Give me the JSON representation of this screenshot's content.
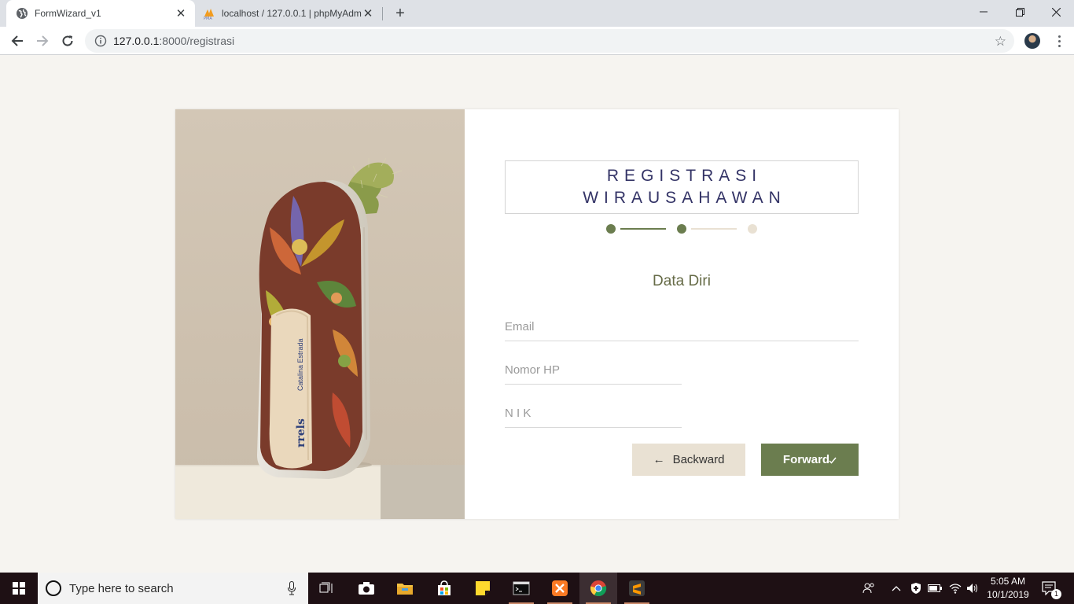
{
  "browser": {
    "tabs": [
      {
        "title": "FormWizard_v1",
        "icon": "globe-icon",
        "active": true
      },
      {
        "title": "localhost / 127.0.0.1 | phpMyAdmin",
        "icon": "phpmyadmin-icon",
        "active": false
      }
    ],
    "address": {
      "host": "127.0.0.1",
      "path": ":8000/registrasi"
    }
  },
  "form": {
    "title_line1": "REGISTRASI",
    "title_line2": "WIRAUSAHAWAN",
    "steps": {
      "total": 3,
      "current": 2,
      "active_color": "#6b7d4f",
      "inactive_color": "#e9e1d3"
    },
    "section_title": "Data Diri",
    "fields": {
      "email": {
        "placeholder": "Email",
        "value": ""
      },
      "phone": {
        "placeholder": "Nomor HP",
        "value": ""
      },
      "nik": {
        "placeholder": "N I K",
        "value": ""
      }
    },
    "buttons": {
      "backward": "Backward",
      "backward_icon": "←",
      "forward": "Forward"
    }
  },
  "hero_image": {
    "brand_text": "rrels",
    "collab_text": "Catalina Estrada"
  },
  "taskbar": {
    "search_placeholder": "Type here to search",
    "time": "5:05 AM",
    "date": "10/1/2019",
    "notification_count": "1"
  },
  "colors": {
    "accent": "#6b7d4f",
    "title": "#333366",
    "page_bg": "#f6f4f0"
  }
}
